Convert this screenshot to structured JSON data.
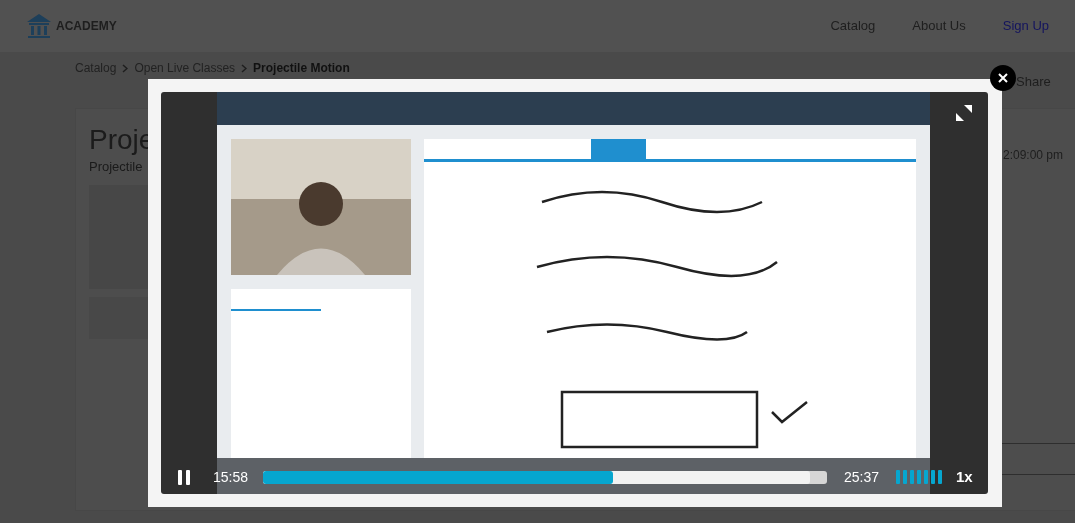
{
  "header": {
    "logo": "ACADEMY",
    "nav": [
      {
        "label": "Catalog",
        "kind": "link"
      },
      {
        "label": "About Us",
        "kind": "link"
      },
      {
        "label": "Sign Up",
        "kind": "accent"
      }
    ]
  },
  "breadcrumb": [
    {
      "label": "Catalog",
      "current": false
    },
    {
      "label": "Open Live Classes",
      "current": false
    },
    {
      "label": "Projectile Motion",
      "current": true
    }
  ],
  "class_page": {
    "title": "Proje",
    "subtitle": "Projectile",
    "share": "Share",
    "time": "2:09:00 pm"
  },
  "video_player": {
    "playing": true,
    "elapsed": "15:58",
    "duration": "25:37",
    "progress": {
      "level": 0.62
    },
    "buffered": {
      "level": 0.97
    },
    "volume": {
      "level": 1
    },
    "speed": "1x"
  }
}
